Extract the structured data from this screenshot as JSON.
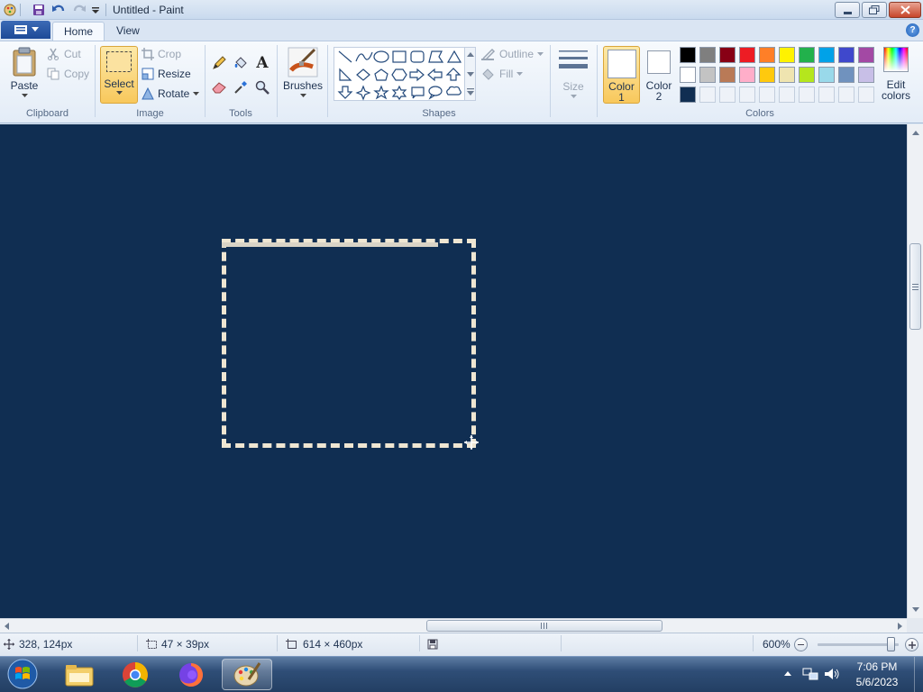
{
  "window": {
    "title": "Untitled - Paint",
    "minimize_icon": "minimize-icon",
    "maximize_icon": "restore-icon",
    "close_icon": "close-icon"
  },
  "quick_access": {
    "icons": [
      "paint-app-icon",
      "save-icon",
      "undo-icon",
      "redo-icon",
      "customize-dropdown-icon"
    ]
  },
  "tabs": [
    {
      "label": "Home",
      "active": true
    },
    {
      "label": "View",
      "active": false
    }
  ],
  "help_icon": "help-icon",
  "ribbon": {
    "clipboard": {
      "group_label": "Clipboard",
      "paste": "Paste",
      "cut": "Cut",
      "copy": "Copy"
    },
    "image": {
      "group_label": "Image",
      "select": "Select",
      "crop": "Crop",
      "resize": "Resize",
      "rotate": "Rotate"
    },
    "tools": {
      "group_label": "Tools",
      "items": [
        "pencil-icon",
        "fill-icon",
        "text-icon",
        "eraser-icon",
        "color-picker-icon",
        "magnifier-icon"
      ]
    },
    "brushes": {
      "label": "Brushes"
    },
    "shapes": {
      "group_label": "Shapes",
      "outline": "Outline",
      "fill": "Fill"
    },
    "size": {
      "label": "Size"
    },
    "colors": {
      "group_label": "Colors",
      "color1": {
        "label_line1": "Color",
        "label_line2": "1",
        "value": "#ffffff"
      },
      "color2": {
        "label_line1": "Color",
        "label_line2": "2",
        "value": "#ffffff"
      },
      "edit_line1": "Edit",
      "edit_line2": "colors",
      "palette_row1": [
        "#000000",
        "#7f7f7f",
        "#880015",
        "#ed1c24",
        "#ff7f27",
        "#fff200",
        "#22b14c",
        "#00a2e8",
        "#3f48cc",
        "#a349a4"
      ],
      "palette_row2": [
        "#ffffff",
        "#c3c3c3",
        "#b97a57",
        "#ffaec9",
        "#ffc90e",
        "#efe4b0",
        "#b5e61d",
        "#99d9ea",
        "#7092be",
        "#c8bfe7"
      ],
      "palette_row3": [
        "#102e52",
        "",
        "",
        "",
        "",
        "",
        "",
        "",
        "",
        ""
      ]
    }
  },
  "canvas": {
    "background": "#102e52"
  },
  "status": {
    "cursor_pos": "328, 124px",
    "selection_size": "47 × 39px",
    "image_size": "614 × 460px",
    "zoom": "600%",
    "zoom_level": 0.9
  },
  "taskbar": {
    "apps": [
      "windows-start-icon",
      "file-explorer-icon",
      "chrome-icon",
      "firefox-icon",
      "paint-icon"
    ],
    "time": "7:06 PM",
    "date": "5/6/2023"
  }
}
